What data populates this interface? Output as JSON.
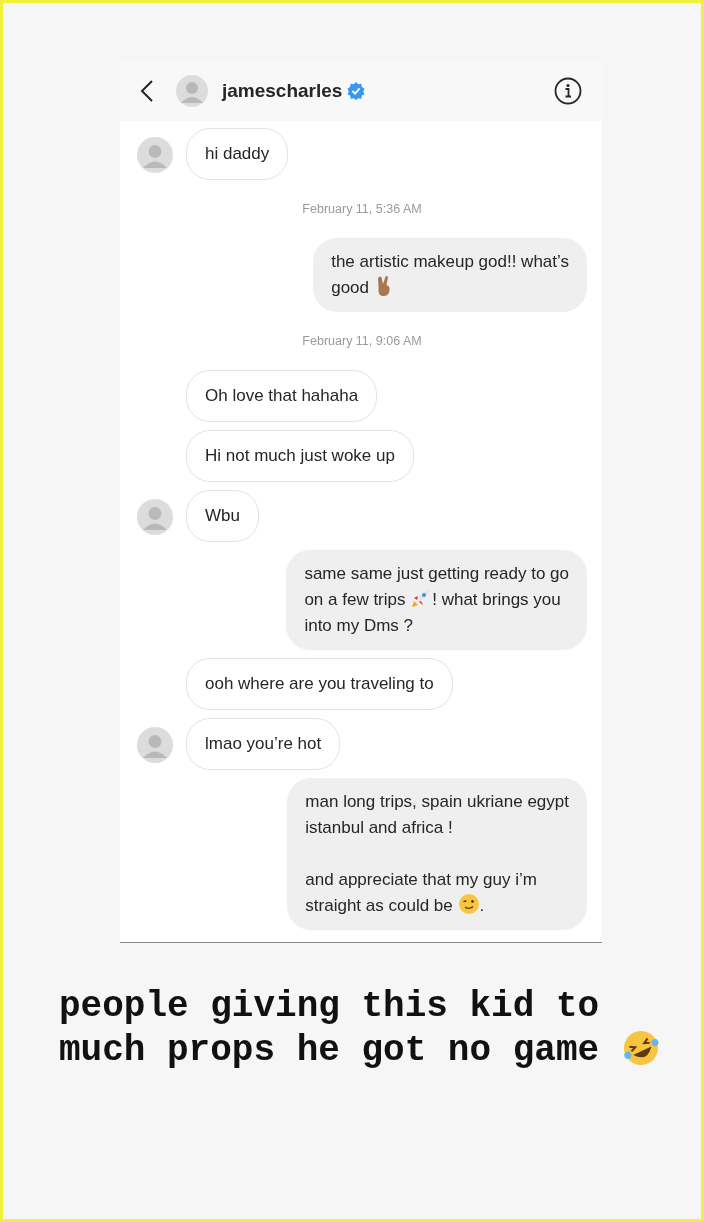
{
  "header": {
    "username": "jamescharles",
    "verified": true
  },
  "messages": [
    {
      "kind": "incoming",
      "avatar": true,
      "paragraphs": [
        [
          [
            {
              "kind": "text",
              "text": "hi daddy"
            }
          ]
        ]
      ]
    },
    {
      "kind": "timestamp",
      "text": "February 11, 5:36 AM"
    },
    {
      "kind": "outgoing",
      "paragraphs": [
        [
          [
            {
              "kind": "text",
              "text": "the artistic makeup god!! what’s"
            }
          ],
          [
            {
              "kind": "text",
              "text": "good "
            },
            {
              "kind": "victory-hand"
            }
          ]
        ]
      ]
    },
    {
      "kind": "timestamp",
      "text": "February 11, 9:06 AM"
    },
    {
      "kind": "incoming",
      "avatar": false,
      "paragraphs": [
        [
          [
            {
              "kind": "text",
              "text": "Oh love that hahaha"
            }
          ]
        ]
      ]
    },
    {
      "kind": "incoming",
      "avatar": false,
      "paragraphs": [
        [
          [
            {
              "kind": "text",
              "text": "Hi not much just woke up"
            }
          ]
        ]
      ]
    },
    {
      "kind": "incoming",
      "avatar": true,
      "paragraphs": [
        [
          [
            {
              "kind": "text",
              "text": "Wbu"
            }
          ]
        ]
      ]
    },
    {
      "kind": "outgoing",
      "paragraphs": [
        [
          [
            {
              "kind": "text",
              "text": "same same just getting ready to go"
            }
          ],
          [
            {
              "kind": "text",
              "text": "on a few trips "
            },
            {
              "kind": "rocket"
            },
            {
              "kind": "text",
              "text": "! what brings you"
            }
          ],
          [
            {
              "kind": "text",
              "text": "into my Dms ?"
            }
          ]
        ]
      ]
    },
    {
      "kind": "incoming",
      "avatar": false,
      "paragraphs": [
        [
          [
            {
              "kind": "text",
              "text": "ooh where are you traveling to"
            }
          ]
        ]
      ]
    },
    {
      "kind": "incoming",
      "avatar": true,
      "paragraphs": [
        [
          [
            {
              "kind": "text",
              "text": "lmao you’re hot"
            }
          ]
        ]
      ]
    },
    {
      "kind": "outgoing",
      "paragraphs": [
        [
          [
            {
              "kind": "text",
              "text": "man long trips, spain ukriane egypt"
            }
          ],
          [
            {
              "kind": "text",
              "text": "istanbul and africa !"
            }
          ]
        ],
        [
          [
            {
              "kind": "text",
              "text": "and appreciate that my guy i’m"
            }
          ],
          [
            {
              "kind": "text",
              "text": "straight as could be "
            },
            {
              "kind": "wink"
            },
            {
              "kind": "text",
              "text": "."
            }
          ]
        ]
      ]
    }
  ],
  "caption": {
    "parts": [
      {
        "kind": "text",
        "text": "people giving this kid to much props he got no game "
      },
      {
        "kind": "laughing"
      }
    ]
  }
}
